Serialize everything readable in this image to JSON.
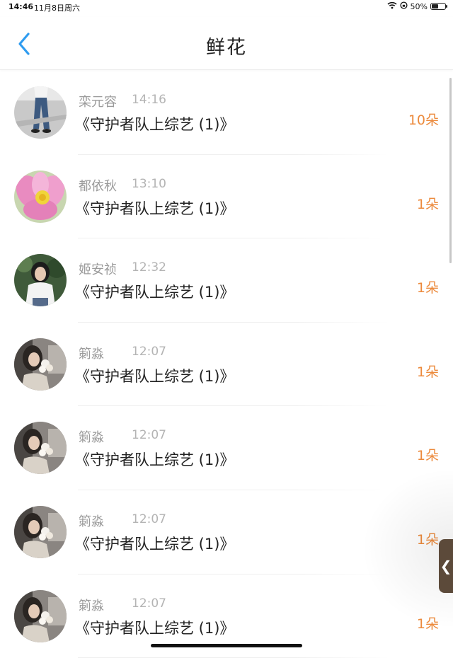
{
  "status_bar": {
    "time": "14:46",
    "date": "11月8日周六",
    "battery_text": "50%",
    "battery_level": 0.5
  },
  "nav": {
    "title": "鲜花",
    "back_icon": "chevron-left-icon"
  },
  "colors": {
    "accent_blue": "#2f9cf0",
    "count_orange": "#ec8a3c",
    "meta_gray": "#9b9b9b"
  },
  "list": [
    {
      "name": "栾元容",
      "time": "14:16",
      "title": "《守护者队上综艺 (1)》",
      "count": "10朵",
      "avatar": "avatar-jeans"
    },
    {
      "name": "都依秋",
      "time": "13:10",
      "title": "《守护者队上综艺 (1)》",
      "count": "1朵",
      "avatar": "avatar-flower"
    },
    {
      "name": "姬安祯",
      "time": "12:32",
      "title": "《守护者队上综艺 (1)》",
      "count": "1朵",
      "avatar": "avatar-girl-white-shirt"
    },
    {
      "name": "箣淼",
      "time": "12:07",
      "title": "《守护者队上综艺 (1)》",
      "count": "1朵",
      "avatar": "avatar-girl-bouquet"
    },
    {
      "name": "箣淼",
      "time": "12:07",
      "title": "《守护者队上综艺 (1)》",
      "count": "1朵",
      "avatar": "avatar-girl-bouquet"
    },
    {
      "name": "箣淼",
      "time": "12:07",
      "title": "《守护者队上综艺 (1)》",
      "count": "1朵",
      "avatar": "avatar-girl-bouquet"
    },
    {
      "name": "箣淼",
      "time": "12:07",
      "title": "《守护者队上综艺 (1)》",
      "count": "1朵",
      "avatar": "avatar-girl-bouquet"
    }
  ],
  "side_tab": {
    "glyph": "❮",
    "icon": "chevron-left-icon"
  }
}
